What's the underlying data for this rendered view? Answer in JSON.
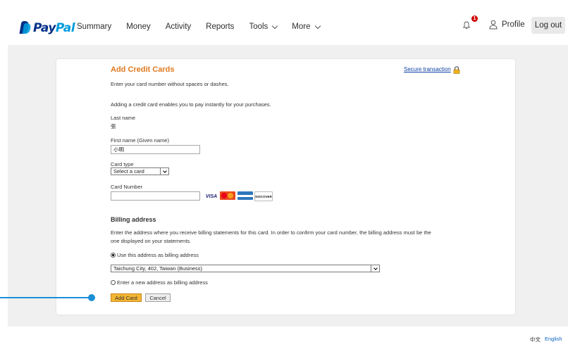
{
  "header": {
    "logo": {
      "pay": "Pay",
      "pal": "Pal"
    },
    "nav": [
      {
        "label": "Summary",
        "dropdown": false
      },
      {
        "label": "Money",
        "dropdown": false
      },
      {
        "label": "Activity",
        "dropdown": false
      },
      {
        "label": "Reports",
        "dropdown": false
      },
      {
        "label": "Tools",
        "dropdown": true
      },
      {
        "label": "More",
        "dropdown": true
      }
    ],
    "notification_count": "1",
    "profile_label": "Profile",
    "logout_label": "Log out"
  },
  "form": {
    "title": "Add Credit Cards",
    "secure_link": "Secure transaction",
    "instruction": "Enter your card number without spaces or dashes.",
    "info": "Adding a credit card enables you to pay instantly for your purchases.",
    "last_name_label": "Last name",
    "last_name_value": "張",
    "first_name_label": "First name (Given name)",
    "first_name_value": "小明",
    "card_type_label": "Card type",
    "card_type_value": "Select a card",
    "card_number_label": "Card Number",
    "card_number_value": "",
    "card_brands": [
      "VISA",
      "MasterCard",
      "AMEX",
      "DISCOVER"
    ]
  },
  "billing": {
    "title": "Billing address",
    "description_line1": "Enter the address where you receive billing statements for this card. In order to confirm your card number, the billing address must be the",
    "description_line2": "one displayed on your statements.",
    "option_use": "Use this address as billing address",
    "address_value": "Taichung City, 402, Taiwan (Business)",
    "option_new": "Enter a new address as billing address"
  },
  "actions": {
    "add_card": "Add Card",
    "cancel": "Cancel"
  },
  "footer": {
    "lang_zh": "中文",
    "lang_en": "English"
  },
  "colors": {
    "accent_orange": "#e07a1f",
    "link_blue": "#0b3fa3",
    "paypal_navy": "#003087",
    "paypal_blue": "#009cde",
    "pointer": "#1a8fd6"
  }
}
